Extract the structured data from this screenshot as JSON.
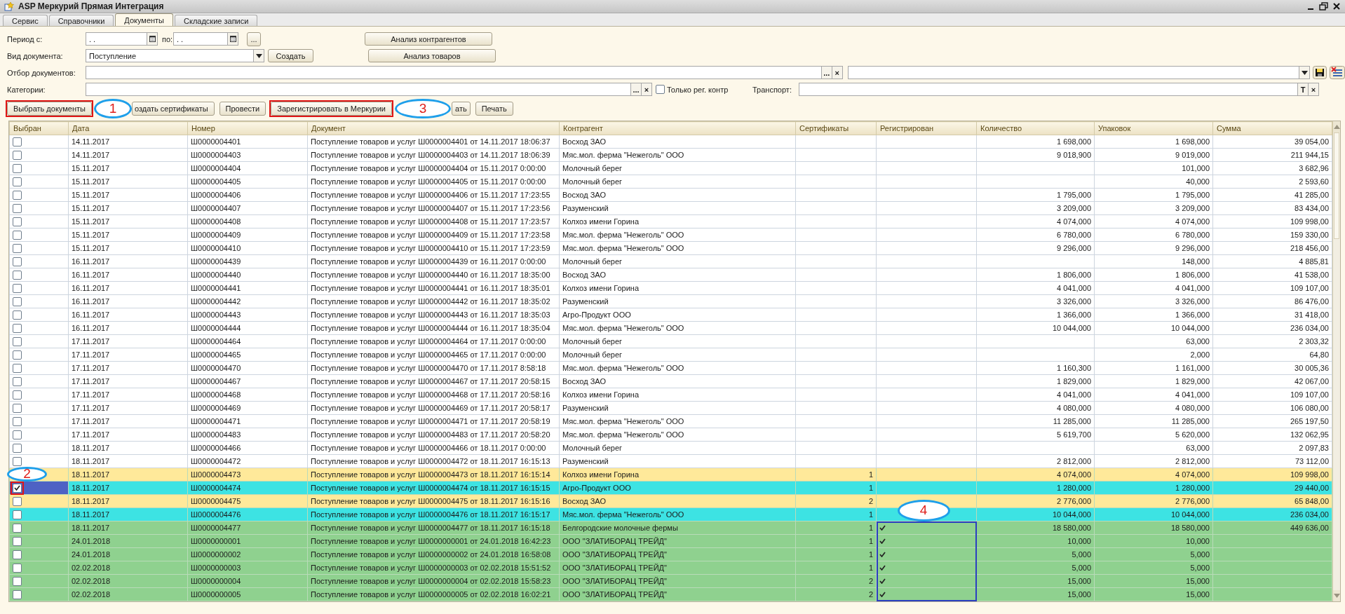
{
  "window": {
    "title": "ASP Меркурий Прямая Интеграция"
  },
  "tabs": [
    {
      "label": "Сервис",
      "selected": false
    },
    {
      "label": "Справочники",
      "selected": false
    },
    {
      "label": "Документы",
      "selected": true
    },
    {
      "label": "Складские записи",
      "selected": false
    }
  ],
  "filters": {
    "period_label": "Период с:",
    "period_from": ". .",
    "period_to_label": "по:",
    "period_to": ". .",
    "period_button": "...",
    "doc_type_label": "Вид документа:",
    "doc_type": "Поступление",
    "create_button": "Создать",
    "analysis_buttons": [
      "Анализ контрагентов",
      "Анализ товаров"
    ],
    "selection_label": "Отбор документов:",
    "selection_buttons": [
      "...",
      "×"
    ],
    "categories_label": "Категории:",
    "categories_buttons": [
      "...",
      "×"
    ],
    "only_registered": {
      "label": "Только рег. контр",
      "checked": false
    },
    "transport_label": "Транспорт:",
    "transport_buttons": [
      "T",
      "×"
    ]
  },
  "toolbar": [
    {
      "label": "Выбрать документы"
    },
    {
      "label": "оздать сертификаты"
    },
    {
      "label": "Провести"
    },
    {
      "label": "Зарегистрировать в Меркурии"
    },
    {
      "label": "ать"
    },
    {
      "label": "Печать"
    }
  ],
  "table": {
    "columns": [
      "Выбран",
      "Дата",
      "Номер",
      "Документ",
      "Контрагент",
      "Сертификаты",
      "Регистрирован",
      "Количество",
      "Упаковок",
      "Сумма"
    ],
    "rows": [
      {
        "checked": false,
        "selected": false,
        "color": "#ffffff",
        "date": "14.11.2017",
        "number": "Ш0000004401",
        "document": "Поступление товаров и услуг Ш0000004401 от 14.11.2017 18:06:37",
        "counterparty": "Восход ЗАО",
        "registered": false,
        "quantity": "1 698,000",
        "packages": "1 698,000",
        "sum": "39 054,00"
      },
      {
        "checked": false,
        "selected": false,
        "color": "#ffffff",
        "date": "14.11.2017",
        "number": "Ш0000004403",
        "document": "Поступление товаров и услуг Ш0000004403 от 14.11.2017 18:06:39",
        "counterparty": "Мяс.мол. ферма \"Нежеголь\" ООО",
        "registered": false,
        "quantity": "9 018,900",
        "packages": "9 019,000",
        "sum": "211 944,15"
      },
      {
        "checked": false,
        "selected": false,
        "color": "#ffffff",
        "date": "15.11.2017",
        "number": "Ш0000004404",
        "document": "Поступление товаров и услуг Ш0000004404 от 15.11.2017 0:00:00",
        "counterparty": "Молочный берег",
        "registered": false,
        "packages": "101,000",
        "sum": "3 682,96"
      },
      {
        "checked": false,
        "selected": false,
        "color": "#ffffff",
        "date": "15.11.2017",
        "number": "Ш0000004405",
        "document": "Поступление товаров и услуг Ш0000004405 от 15.11.2017 0:00:00",
        "counterparty": "Молочный берег",
        "registered": false,
        "packages": "40,000",
        "sum": "2 593,60"
      },
      {
        "checked": false,
        "selected": false,
        "color": "#ffffff",
        "date": "15.11.2017",
        "number": "Ш0000004406",
        "document": "Поступление товаров и услуг Ш0000004406 от 15.11.2017 17:23:55",
        "counterparty": "Восход ЗАО",
        "registered": false,
        "quantity": "1 795,000",
        "packages": "1 795,000",
        "sum": "41 285,00"
      },
      {
        "checked": false,
        "selected": false,
        "color": "#ffffff",
        "date": "15.11.2017",
        "number": "Ш0000004407",
        "document": "Поступление товаров и услуг Ш0000004407 от 15.11.2017 17:23:56",
        "counterparty": "Разуменский",
        "registered": false,
        "quantity": "3 209,000",
        "packages": "3 209,000",
        "sum": "83 434,00"
      },
      {
        "checked": false,
        "selected": false,
        "color": "#ffffff",
        "date": "15.11.2017",
        "number": "Ш0000004408",
        "document": "Поступление товаров и услуг Ш0000004408 от 15.11.2017 17:23:57",
        "counterparty": "Колхоз имени Горина",
        "registered": false,
        "quantity": "4 074,000",
        "packages": "4 074,000",
        "sum": "109 998,00"
      },
      {
        "checked": false,
        "selected": false,
        "color": "#ffffff",
        "date": "15.11.2017",
        "number": "Ш0000004409",
        "document": "Поступление товаров и услуг Ш0000004409 от 15.11.2017 17:23:58",
        "counterparty": "Мяс.мол. ферма \"Нежеголь\" ООО",
        "registered": false,
        "quantity": "6 780,000",
        "packages": "6 780,000",
        "sum": "159 330,00"
      },
      {
        "checked": false,
        "selected": false,
        "color": "#ffffff",
        "date": "15.11.2017",
        "number": "Ш0000004410",
        "document": "Поступление товаров и услуг Ш0000004410 от 15.11.2017 17:23:59",
        "counterparty": "Мяс.мол. ферма \"Нежеголь\" ООО",
        "registered": false,
        "quantity": "9 296,000",
        "packages": "9 296,000",
        "sum": "218 456,00"
      },
      {
        "checked": false,
        "selected": false,
        "color": "#ffffff",
        "date": "16.11.2017",
        "number": "Ш0000004439",
        "document": "Поступление товаров и услуг Ш0000004439 от 16.11.2017 0:00:00",
        "counterparty": "Молочный берег",
        "registered": false,
        "packages": "148,000",
        "sum": "4 885,81"
      },
      {
        "checked": false,
        "selected": false,
        "color": "#ffffff",
        "date": "16.11.2017",
        "number": "Ш0000004440",
        "document": "Поступление товаров и услуг Ш0000004440 от 16.11.2017 18:35:00",
        "counterparty": "Восход ЗАО",
        "registered": false,
        "quantity": "1 806,000",
        "packages": "1 806,000",
        "sum": "41 538,00"
      },
      {
        "checked": false,
        "selected": false,
        "color": "#ffffff",
        "date": "16.11.2017",
        "number": "Ш0000004441",
        "document": "Поступление товаров и услуг Ш0000004441 от 16.11.2017 18:35:01",
        "counterparty": "Колхоз имени Горина",
        "registered": false,
        "quantity": "4 041,000",
        "packages": "4 041,000",
        "sum": "109 107,00"
      },
      {
        "checked": false,
        "selected": false,
        "color": "#ffffff",
        "date": "16.11.2017",
        "number": "Ш0000004442",
        "document": "Поступление товаров и услуг Ш0000004442 от 16.11.2017 18:35:02",
        "counterparty": "Разуменский",
        "registered": false,
        "quantity": "3 326,000",
        "packages": "3 326,000",
        "sum": "86 476,00"
      },
      {
        "checked": false,
        "selected": false,
        "color": "#ffffff",
        "date": "16.11.2017",
        "number": "Ш0000004443",
        "document": "Поступление товаров и услуг Ш0000004443 от 16.11.2017 18:35:03",
        "counterparty": "Агро-Продукт ООО",
        "registered": false,
        "quantity": "1 366,000",
        "packages": "1 366,000",
        "sum": "31 418,00"
      },
      {
        "checked": false,
        "selected": false,
        "color": "#ffffff",
        "date": "16.11.2017",
        "number": "Ш0000004444",
        "document": "Поступление товаров и услуг Ш0000004444 от 16.11.2017 18:35:04",
        "counterparty": "Мяс.мол. ферма \"Нежеголь\" ООО",
        "registered": false,
        "quantity": "10 044,000",
        "packages": "10 044,000",
        "sum": "236 034,00"
      },
      {
        "checked": false,
        "selected": false,
        "color": "#ffffff",
        "date": "17.11.2017",
        "number": "Ш0000004464",
        "document": "Поступление товаров и услуг Ш0000004464 от 17.11.2017 0:00:00",
        "counterparty": "Молочный берег",
        "registered": false,
        "packages": "63,000",
        "sum": "2 303,32"
      },
      {
        "checked": false,
        "selected": false,
        "color": "#ffffff",
        "date": "17.11.2017",
        "number": "Ш0000004465",
        "document": "Поступление товаров и услуг Ш0000004465 от 17.11.2017 0:00:00",
        "counterparty": "Молочный берег",
        "registered": false,
        "packages": "2,000",
        "sum": "64,80"
      },
      {
        "checked": false,
        "selected": false,
        "color": "#ffffff",
        "date": "17.11.2017",
        "number": "Ш0000004470",
        "document": "Поступление товаров и услуг Ш0000004470 от 17.11.2017 8:58:18",
        "counterparty": "Мяс.мол. ферма \"Нежеголь\" ООО",
        "registered": false,
        "quantity": "1 160,300",
        "packages": "1 161,000",
        "sum": "30 005,36"
      },
      {
        "checked": false,
        "selected": false,
        "color": "#ffffff",
        "date": "17.11.2017",
        "number": "Ш0000004467",
        "document": "Поступление товаров и услуг Ш0000004467 от 17.11.2017 20:58:15",
        "counterparty": "Восход ЗАО",
        "registered": false,
        "quantity": "1 829,000",
        "packages": "1 829,000",
        "sum": "42 067,00"
      },
      {
        "checked": false,
        "selected": false,
        "color": "#ffffff",
        "date": "17.11.2017",
        "number": "Ш0000004468",
        "document": "Поступление товаров и услуг Ш0000004468 от 17.11.2017 20:58:16",
        "counterparty": "Колхоз имени Горина",
        "registered": false,
        "quantity": "4 041,000",
        "packages": "4 041,000",
        "sum": "109 107,00"
      },
      {
        "checked": false,
        "selected": false,
        "color": "#ffffff",
        "date": "17.11.2017",
        "number": "Ш0000004469",
        "document": "Поступление товаров и услуг Ш0000004469 от 17.11.2017 20:58:17",
        "counterparty": "Разуменский",
        "registered": false,
        "quantity": "4 080,000",
        "packages": "4 080,000",
        "sum": "106 080,00"
      },
      {
        "checked": false,
        "selected": false,
        "color": "#ffffff",
        "date": "17.11.2017",
        "number": "Ш0000004471",
        "document": "Поступление товаров и услуг Ш0000004471 от 17.11.2017 20:58:19",
        "counterparty": "Мяс.мол. ферма \"Нежеголь\" ООО",
        "registered": false,
        "quantity": "11 285,000",
        "packages": "11 285,000",
        "sum": "265 197,50"
      },
      {
        "checked": false,
        "selected": false,
        "color": "#ffffff",
        "date": "17.11.2017",
        "number": "Ш0000004483",
        "document": "Поступление товаров и услуг Ш0000004483 от 17.11.2017 20:58:20",
        "counterparty": "Мяс.мол. ферма \"Нежеголь\" ООО",
        "registered": false,
        "quantity": "5 619,700",
        "packages": "5 620,000",
        "sum": "132 062,95"
      },
      {
        "checked": false,
        "selected": false,
        "color": "#ffffff",
        "date": "18.11.2017",
        "number": "Ш0000004466",
        "document": "Поступление товаров и услуг Ш0000004466 от 18.11.2017 0:00:00",
        "counterparty": "Молочный берег",
        "registered": false,
        "packages": "63,000",
        "sum": "2 097,83"
      },
      {
        "checked": false,
        "selected": false,
        "color": "#ffffff",
        "date": "18.11.2017",
        "number": "Ш0000004472",
        "document": "Поступление товаров и услуг Ш0000004472 от 18.11.2017 16:15:13",
        "counterparty": "Разуменский",
        "registered": false,
        "quantity": "2 812,000",
        "packages": "2 812,000",
        "sum": "73 112,00"
      },
      {
        "selected": false,
        "color": "#ffe99a",
        "date": "18.11.2017",
        "number": "Ш0000004473",
        "document": "Поступление товаров и услуг Ш0000004473 от 18.11.2017 16:15:14",
        "counterparty": "Колхоз имени Горина",
        "certificates": "1",
        "registered": false,
        "quantity": "4 074,000",
        "packages": "4 074,000",
        "sum": "109 998,00"
      },
      {
        "checked": true,
        "selected": true,
        "color": "#3de3e3",
        "date": "18.11.2017",
        "number": "Ш0000004474",
        "document": "Поступление товаров и услуг Ш0000004474 от 18.11.2017 16:15:15",
        "counterparty": "Агро-Продукт ООО",
        "certificates": "1",
        "registered": false,
        "quantity": "1 280,000",
        "packages": "1 280,000",
        "sum": "29 440,00"
      },
      {
        "checked": false,
        "selected": false,
        "color": "#ffe99a",
        "date": "18.11.2017",
        "number": "Ш0000004475",
        "document": "Поступление товаров и услуг Ш0000004475 от 18.11.2017 16:15:16",
        "counterparty": "Восход ЗАО",
        "certificates": "2",
        "registered": false,
        "quantity": "2 776,000",
        "packages": "2 776,000",
        "sum": "65 848,00"
      },
      {
        "checked": false,
        "selected": false,
        "color": "#3de3e3",
        "date": "18.11.2017",
        "number": "Ш0000004476",
        "document": "Поступление товаров и услуг Ш0000004476 от 18.11.2017 16:15:17",
        "counterparty": "Мяс.мол. ферма \"Нежеголь\" ООО",
        "certificates": "1",
        "registered": false,
        "quantity": "10 044,000",
        "packages": "10 044,000",
        "sum": "236 034,00"
      },
      {
        "checked": false,
        "selected": false,
        "color": "#8fd18f",
        "date": "18.11.2017",
        "number": "Ш0000004477",
        "document": "Поступление товаров и услуг Ш0000004477 от 18.11.2017 16:15:18",
        "counterparty": "Белгородские молочные фермы",
        "certificates": "1",
        "registered": true,
        "quantity": "18 580,000",
        "packages": "18 580,000",
        "sum": "449 636,00"
      },
      {
        "checked": false,
        "selected": false,
        "color": "#8fd18f",
        "date": "24.01.2018",
        "number": "Ш0000000001",
        "document": "Поступление товаров и услуг Ш0000000001 от 24.01.2018 16:42:23",
        "counterparty": "ООО \"ЗЛАТИБОРАЦ ТРЕЙД\"",
        "certificates": "1",
        "registered": true,
        "quantity": "10,000",
        "packages": "10,000"
      },
      {
        "checked": false,
        "selected": false,
        "color": "#8fd18f",
        "date": "24.01.2018",
        "number": "Ш0000000002",
        "document": "Поступление товаров и услуг Ш0000000002 от 24.01.2018 16:58:08",
        "counterparty": "ООО \"ЗЛАТИБОРАЦ ТРЕЙД\"",
        "certificates": "1",
        "registered": true,
        "quantity": "5,000",
        "packages": "5,000"
      },
      {
        "checked": false,
        "selected": false,
        "color": "#8fd18f",
        "date": "02.02.2018",
        "number": "Ш0000000003",
        "document": "Поступление товаров и услуг Ш0000000003 от 02.02.2018 15:51:52",
        "counterparty": "ООО \"ЗЛАТИБОРАЦ ТРЕЙД\"",
        "certificates": "1",
        "registered": true,
        "quantity": "5,000",
        "packages": "5,000"
      },
      {
        "checked": false,
        "selected": false,
        "color": "#8fd18f",
        "date": "02.02.2018",
        "number": "Ш0000000004",
        "document": "Поступление товаров и услуг Ш0000000004 от 02.02.2018 15:58:23",
        "counterparty": "ООО \"ЗЛАТИБОРАЦ ТРЕЙД\"",
        "certificates": "2",
        "registered": true,
        "quantity": "15,000",
        "packages": "15,000"
      },
      {
        "checked": false,
        "selected": false,
        "color": "#8fd18f",
        "date": "02.02.2018",
        "number": "Ш0000000005",
        "document": "Поступление товаров и услуг Ш0000000005 от 02.02.2018 16:02:21",
        "counterparty": "ООО \"ЗЛАТИБОРАЦ ТРЕЙД\"",
        "certificates": "2",
        "registered": true,
        "quantity": "15,000",
        "packages": "15,000"
      }
    ]
  },
  "annotations": [
    {
      "kind": "frame",
      "color": "#e01515"
    },
    {
      "kind": "oval",
      "number": "1"
    },
    {
      "kind": "frame",
      "color": "#e01515"
    },
    {
      "kind": "oval",
      "number": "3"
    },
    {
      "kind": "oval",
      "number": "2"
    },
    {
      "kind": "frame",
      "color": "#e01515"
    },
    {
      "kind": "oval",
      "number": "4"
    },
    {
      "kind": "frame",
      "color": "#2b3fc0"
    }
  ]
}
